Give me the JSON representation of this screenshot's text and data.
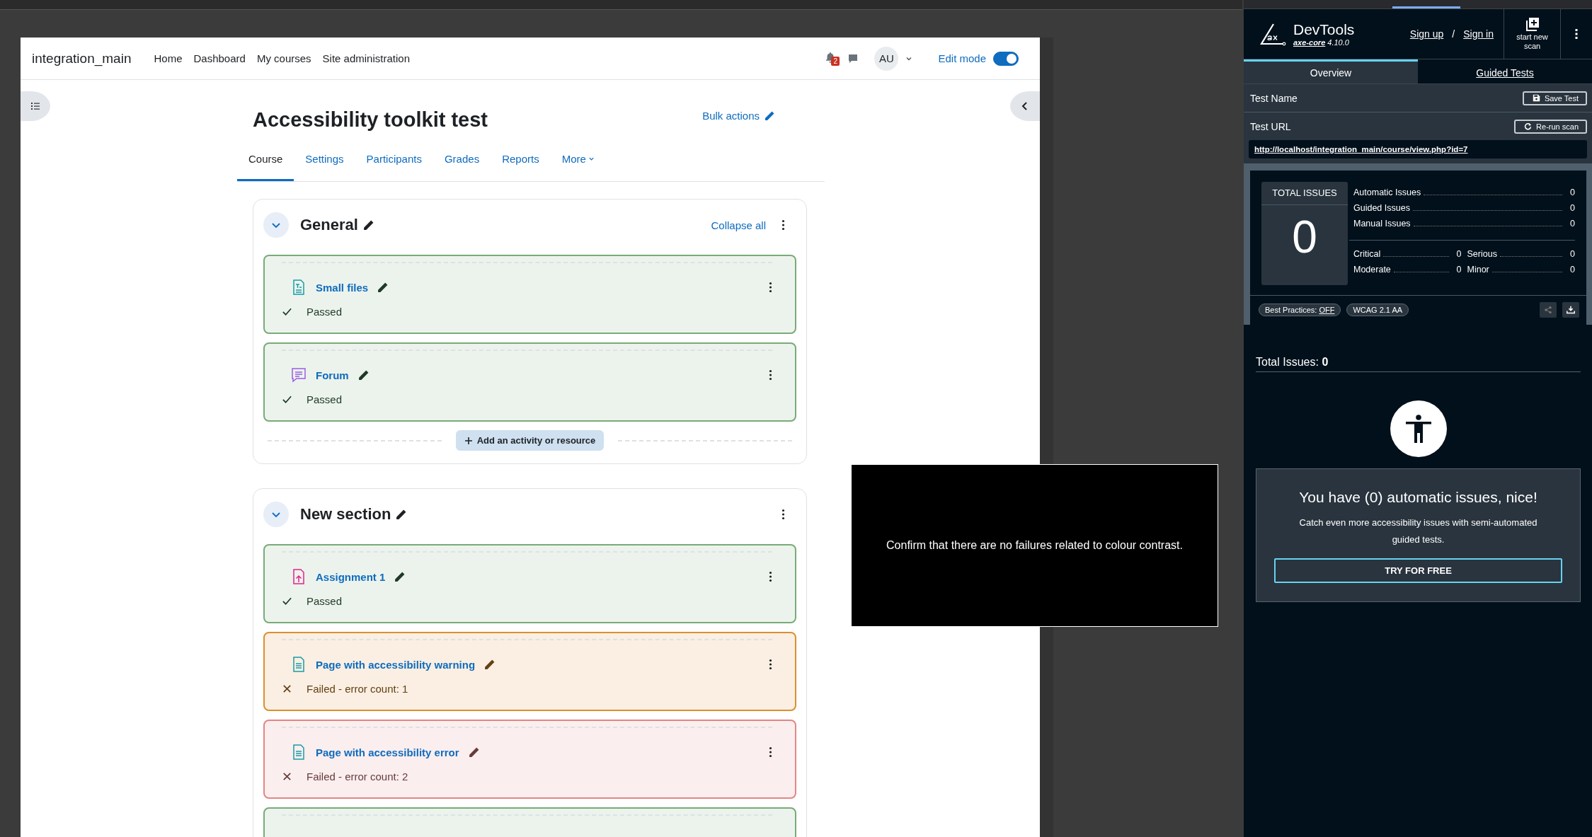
{
  "site": {
    "name": "integration_main",
    "nav": [
      "Home",
      "Dashboard",
      "My courses",
      "Site administration"
    ],
    "notification_count": "2",
    "avatar": "AU",
    "edit_mode": {
      "label": "Edit mode",
      "on": true
    }
  },
  "course": {
    "title": "Accessibility toolkit test",
    "bulk_actions": "Bulk actions",
    "tabs": [
      {
        "label": "Course",
        "selected": true
      },
      {
        "label": "Settings",
        "selected": false
      },
      {
        "label": "Participants",
        "selected": false
      },
      {
        "label": "Grades",
        "selected": false
      },
      {
        "label": "Reports",
        "selected": false
      },
      {
        "label": "More",
        "selected": false
      }
    ],
    "sections": [
      {
        "title": "General",
        "expanded": true,
        "collapse_all": "Collapse all",
        "add_activity": "Add an activity or resource",
        "activities": [
          {
            "name": "Small files",
            "kind": "file",
            "color": "#78ab78",
            "passed": true,
            "result": "Passed"
          },
          {
            "name": "Forum",
            "kind": "forum",
            "color": "#78ab78",
            "passed": true,
            "result": "Passed"
          }
        ]
      },
      {
        "title": "New section",
        "expanded": true,
        "activities": [
          {
            "name": "Assignment 1",
            "kind": "assignment",
            "color": "#78ab78",
            "passed": true,
            "result": "Passed"
          },
          {
            "name": "Page with accessibility warning",
            "kind": "page",
            "color": "#dd8f2d",
            "passed": false,
            "result": "Failed - error count: 1"
          },
          {
            "name": "Page with accessibility error",
            "kind": "page",
            "color": "#e38683",
            "passed": false,
            "result": "Failed - error count: 2"
          },
          {
            "color": "#78ab78"
          }
        ]
      }
    ]
  },
  "overlay": {
    "message": "Confirm that there are no failures related to colour contrast."
  },
  "axe": {
    "product": "DevTools",
    "engine": "axe-core",
    "version": "4.10.0",
    "sign_up": "Sign up",
    "separator": "/",
    "sign_in": "Sign in",
    "new_scan": "start new scan",
    "tabs": [
      {
        "label": "Overview",
        "selected": true
      },
      {
        "label": "Guided Tests",
        "selected": false
      }
    ],
    "test_name_label": "Test Name",
    "save_test": "Save Test",
    "test_url_label": "Test URL",
    "rerun": "Re-run scan",
    "url": "http://localhost/integration_main/course/view.php?id=7",
    "total_label": "TOTAL ISSUES",
    "total": "0",
    "issue_types": [
      {
        "label": "Automatic Issues",
        "count": "0"
      },
      {
        "label": "Guided Issues",
        "count": "0"
      },
      {
        "label": "Manual Issues",
        "count": "0"
      }
    ],
    "severities": [
      {
        "label": "Critical",
        "count": "0"
      },
      {
        "label": "Serious",
        "count": "0"
      },
      {
        "label": "Moderate",
        "count": "0"
      },
      {
        "label": "Minor",
        "count": "0"
      }
    ],
    "best_practices": {
      "label": "Best Practices:",
      "value": "OFF"
    },
    "standard": "WCAG 2.1 AA",
    "summary_label": "Total Issues:",
    "summary_count": "0",
    "promo": {
      "heading": "You have (0) automatic issues, nice!",
      "text": "Catch even more accessibility issues with semi-automated guided tests.",
      "button": "TRY FOR FREE"
    }
  }
}
